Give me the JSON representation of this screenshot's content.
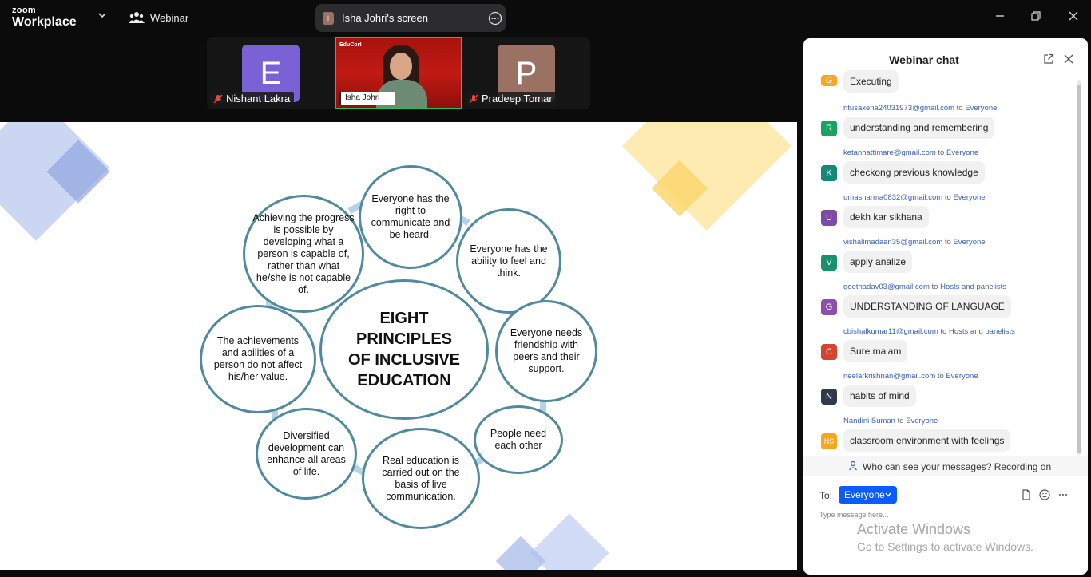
{
  "app": {
    "logo_line1": "zoom",
    "logo_line2": "Workplace",
    "mode_label": "Webinar"
  },
  "share": {
    "presenter_initial": "I",
    "label": "Isha Johri's screen"
  },
  "participants": [
    {
      "initial": "E",
      "name": "Nishant Lakra",
      "color": "#7b61d6",
      "muted": true
    },
    {
      "name": "Isha Johri",
      "overlay_brand": "EduCort",
      "active_speaker": true
    },
    {
      "initial": "P",
      "name": "Pradeep Tomar",
      "color": "#9a7163",
      "muted": true
    }
  ],
  "slide": {
    "center_lines": [
      "EIGHT",
      "PRINCIPLES",
      "OF INCLUSIVE",
      "EDUCATION"
    ],
    "principles": [
      "Everyone has the right to communicate and be heard.",
      "Everyone has the ability to feel and think.",
      "Everyone needs friendship with peers and their support.",
      "People need each other",
      "Real education is carried out on the basis of live communication.",
      "Diversified development can enhance all areas of life.",
      "The achievements and abilities of a person do not affect his/her value.",
      "Achieving the progress is possible by developing what a person is capable of, rather than what he/she is not capable of."
    ],
    "colors": {
      "circle_border": "#4f8a9e",
      "connector": "#b6d3e6",
      "deco_blue": "#9fb3e8",
      "deco_yellow": "#fde7a3"
    }
  },
  "chat": {
    "title": "Webinar chat",
    "messages": [
      {
        "sender": "",
        "to": "",
        "initial": "G",
        "color": "#f5a623",
        "text": "Executing"
      },
      {
        "sender": "ritusaxena24031973@gmail.com",
        "to": "Everyone",
        "initial": "R",
        "color": "#1aa260",
        "text": "understanding  and remembering"
      },
      {
        "sender": "ketanhattimare@gmail.com",
        "to": "Everyone",
        "initial": "K",
        "color": "#14897a",
        "text": "checkong previous knowledge"
      },
      {
        "sender": "umasharma0832@gmail.com",
        "to": "Everyone",
        "initial": "U",
        "color": "#7d4aa8",
        "text": "dekh kar sikhana"
      },
      {
        "sender": "vishalimadaan35@gmail.com",
        "to": "Everyone",
        "initial": "V",
        "color": "#17936b",
        "text": "apply analize"
      },
      {
        "sender": "geethadav03@gmail.com",
        "to": "Hosts and panelists",
        "initial": "G",
        "color": "#8b4fb0",
        "text": "UNDERSTANDING OF LANGUAGE"
      },
      {
        "sender": "cbishalkumar11@gmail.com",
        "to": "Hosts and panelists",
        "initial": "C",
        "color": "#d2452f",
        "text": "Sure ma'am"
      },
      {
        "sender": "neelarkrishnan@gmail.com",
        "to": "Everyone",
        "initial": "N",
        "color": "#2f3a4d",
        "text": "habits of mind"
      },
      {
        "sender": "Nandini Suman",
        "to": "Everyone",
        "initial": "NS",
        "color": "#f5a623",
        "text": "classroom environment with feelings"
      }
    ],
    "to_word": "to",
    "notice": "Who can see your messages? Recording on",
    "to_label": "To:",
    "recipient": "Everyone",
    "placeholder": "Type message here...",
    "watermark_title": "Activate Windows",
    "watermark_sub": "Go to Settings to activate Windows."
  },
  "accent": "#0b5cff"
}
